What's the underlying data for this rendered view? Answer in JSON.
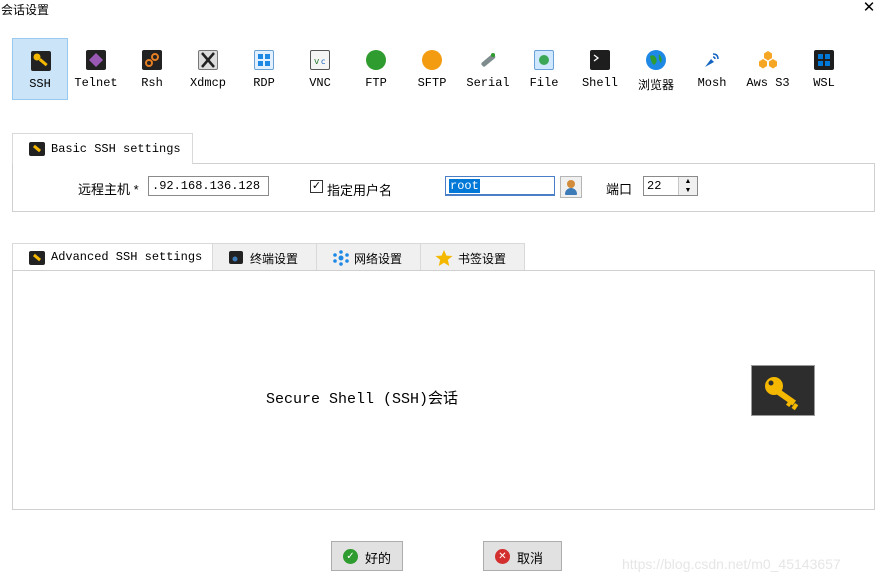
{
  "window": {
    "title": "会话设置",
    "close": "✕"
  },
  "toolbar": {
    "items": [
      {
        "label": "SSH",
        "icon": "ssh-key-icon",
        "color": "#f5b800",
        "bg": "#222222",
        "active": true
      },
      {
        "label": "Telnet",
        "icon": "telnet-icon",
        "color": "#9b59b6",
        "bg": "#222222"
      },
      {
        "label": "Rsh",
        "icon": "rsh-icon",
        "color": "#e67e22",
        "bg": "#222222"
      },
      {
        "label": "Xdmcp",
        "icon": "xdmcp-icon",
        "color": "#333333",
        "bg": "#dddddd"
      },
      {
        "label": "RDP",
        "icon": "rdp-icon",
        "color": "#1e88e5",
        "bg": "#e3f0ff"
      },
      {
        "label": "VNC",
        "icon": "vnc-icon",
        "color": "#2e7d32",
        "bg": "#f5f5f5"
      },
      {
        "label": "FTP",
        "icon": "ftp-icon",
        "color": "#2e9c2e",
        "bg": "#2e9c2e"
      },
      {
        "label": "SFTP",
        "icon": "sftp-icon",
        "color": "#f39c12",
        "bg": "#f39c12"
      },
      {
        "label": "Serial",
        "icon": "serial-icon",
        "color": "#7f8c8d",
        "bg": "#ffffff"
      },
      {
        "label": "File",
        "icon": "file-icon",
        "color": "#3aa757",
        "bg": "#cfe8ff"
      },
      {
        "label": "Shell",
        "icon": "shell-icon",
        "color": "#ffffff",
        "bg": "#1e1e1e"
      },
      {
        "label": "浏览器",
        "icon": "browser-icon",
        "color": "#1e88e5",
        "bg": "#2e9c2e"
      },
      {
        "label": "Mosh",
        "icon": "mosh-icon",
        "color": "#1565c0",
        "bg": "#ffffff"
      },
      {
        "label": "Aws S3",
        "icon": "aws-s3-icon",
        "color": "#f5a623",
        "bg": "#f5a623"
      },
      {
        "label": "WSL",
        "icon": "wsl-icon",
        "color": "#0078d7",
        "bg": "#1e1e1e"
      }
    ]
  },
  "basic": {
    "tab_label": "Basic SSH settings",
    "remote_host_label": "远程主机 *",
    "remote_host_value": ".92.168.136.128",
    "specify_user_checked": true,
    "specify_user_label": "指定用户名",
    "username_value": "root",
    "port_label": "端口",
    "port_value": "22"
  },
  "advanced": {
    "tabs": [
      {
        "label": "Advanced SSH settings",
        "icon": "wrench-icon"
      },
      {
        "label": "终端设置",
        "icon": "terminal-icon"
      },
      {
        "label": "网络设置",
        "icon": "network-icon"
      },
      {
        "label": "书签设置",
        "icon": "star-icon"
      }
    ],
    "description": "Secure Shell (SSH)会话"
  },
  "footer": {
    "ok_label": "好的",
    "cancel_label": "取消",
    "ok_color": "#2e9c2e",
    "cancel_color": "#d32f2f"
  },
  "watermark": "https://blog.csdn.net/m0_45143657"
}
